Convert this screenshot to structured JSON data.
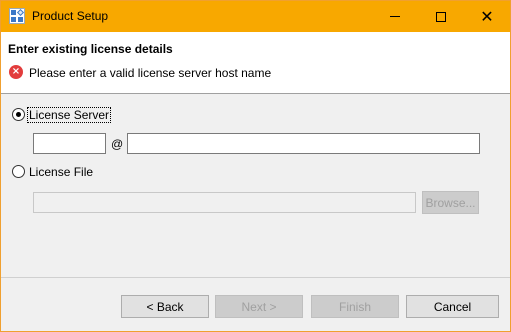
{
  "window": {
    "title": "Product Setup",
    "controls": {
      "minimize": "minimize",
      "maximize": "maximize",
      "close": "✕"
    }
  },
  "header": {
    "title": "Enter existing license details",
    "error_icon": "error-x-icon",
    "error_message": "Please enter a valid license server host name"
  },
  "options": {
    "license_server": {
      "label": "License Server",
      "selected": true
    },
    "port_value": "",
    "at_symbol": "@",
    "host_value": "",
    "license_file": {
      "label": "License File",
      "selected": false
    },
    "file_path_value": "",
    "browse_label": "Browse..."
  },
  "footer": {
    "back_label": "< Back",
    "next_label": "Next >",
    "finish_label": "Finish",
    "cancel_label": "Cancel"
  },
  "colors": {
    "titlebar": "#f8a800",
    "error": "#e23c3c"
  }
}
